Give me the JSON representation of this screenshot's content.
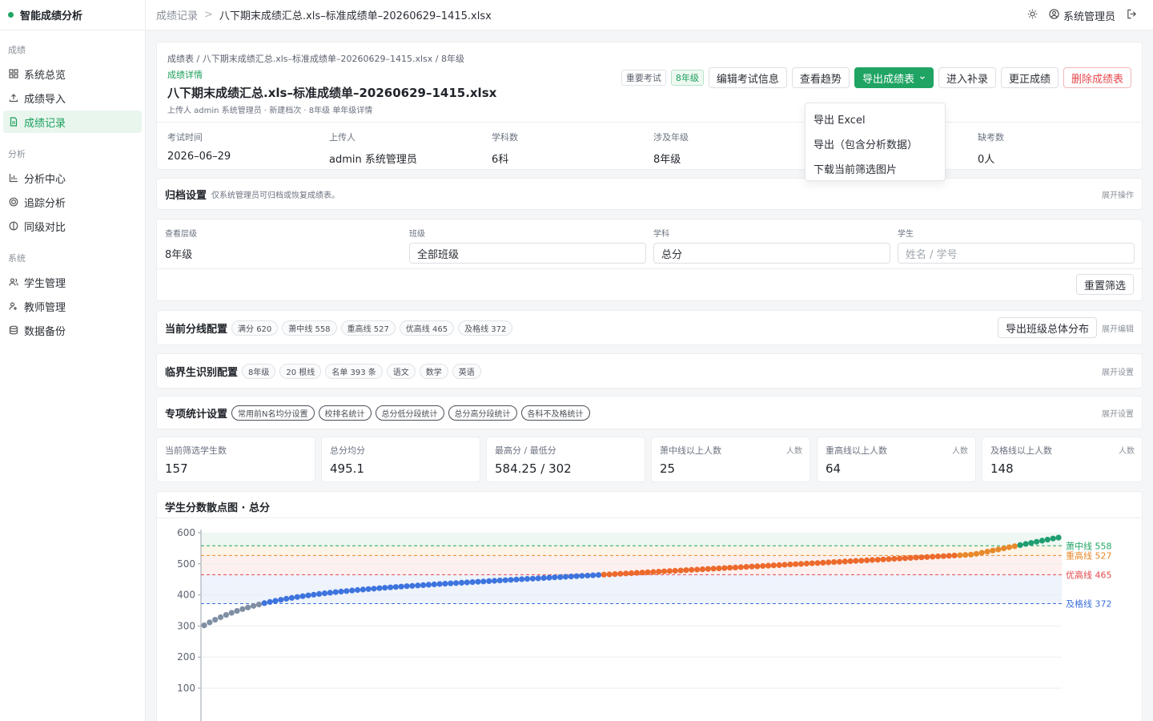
{
  "brand": {
    "name": "智能成绩分析"
  },
  "sidebar": {
    "groups": [
      {
        "label": "成绩",
        "items": [
          {
            "label": "系统总览",
            "icon": "dashboard-icon"
          },
          {
            "label": "成绩导入",
            "icon": "upload-icon"
          },
          {
            "label": "成绩记录",
            "icon": "document-icon",
            "active": true
          }
        ]
      },
      {
        "label": "分析",
        "items": [
          {
            "label": "分析中心",
            "icon": "bar-chart-icon"
          },
          {
            "label": "追踪分析",
            "icon": "target-icon"
          },
          {
            "label": "同级对比",
            "icon": "compare-icon"
          }
        ]
      },
      {
        "label": "系统",
        "items": [
          {
            "label": "学生管理",
            "icon": "users-icon"
          },
          {
            "label": "教师管理",
            "icon": "teacher-icon"
          },
          {
            "label": "数据备份",
            "icon": "database-icon"
          }
        ]
      }
    ]
  },
  "topbar": {
    "breadcrumb_root": "成绩记录",
    "breadcrumb_sep": ">",
    "breadcrumb_current": "八下期末成绩汇总.xls–标准成绩单–20260629–1415.xlsx",
    "user": "系统管理员"
  },
  "header": {
    "crumbs": "成绩表 / 八下期末成绩汇总.xls–标准成绩单–20260629–1415.xlsx / 8年级",
    "subtitle": "成绩详情",
    "title": "八下期末成绩汇总.xls–标准成绩单–20260629–1415.xlsx",
    "meta": "上传人 admin 系统管理员 · 新建档次 · 8年级 单年级详情",
    "tags": [
      "重要考试",
      "8年级"
    ],
    "buttons": {
      "edit": "编辑考试信息",
      "trend": "查看趋势",
      "export": "导出成绩表",
      "makeup": "进入补录",
      "correct": "更正成绩",
      "delete": "删除成绩表"
    },
    "stats": [
      {
        "label": "考试时间",
        "value": "2026–06–29"
      },
      {
        "label": "上传人",
        "value": "admin 系统管理员"
      },
      {
        "label": "学科数",
        "value": "6科"
      },
      {
        "label": "涉及年级",
        "value": "8年级"
      },
      {
        "label": "缺考数",
        "value": "0人"
      }
    ]
  },
  "export_menu": [
    "导出 Excel",
    "导出（包含分析数据）",
    "下载当前筛选图片"
  ],
  "archive": {
    "title": "归档设置",
    "note": "仅系统管理员可归档或恢复成绩表。",
    "action": "展开操作"
  },
  "filters": {
    "level": {
      "label": "查看层级",
      "value": "8年级"
    },
    "class": {
      "label": "班级",
      "value": "全部班级"
    },
    "subject": {
      "label": "学科",
      "value": "总分"
    },
    "student": {
      "label": "学生",
      "placeholder": "姓名 / 学号"
    },
    "reset": "重置筛选"
  },
  "score_lines": {
    "title": "当前分线配置",
    "pills": [
      "满分 620",
      "萧中线 558",
      "重高线 527",
      "优高线 465",
      "及格线 372"
    ],
    "export_btn": "导出班级总体分布",
    "action": "展开编辑"
  },
  "critical": {
    "title": "临界生识别配置",
    "pills": [
      "8年级",
      "20 根线",
      "名单 393 条",
      "语文",
      "数学",
      "英语"
    ],
    "action": "展开设置"
  },
  "special": {
    "title": "专项统计设置",
    "pills": [
      "常用前N名均分设置",
      "校排名统计",
      "总分低分段统计",
      "总分高分段统计",
      "各科不及格统计"
    ],
    "action": "展开设置"
  },
  "kpis": [
    {
      "label": "当前筛选学生数",
      "value": "157",
      "unit": ""
    },
    {
      "label": "总分均分",
      "value": "495.1",
      "unit": ""
    },
    {
      "label": "最高分 / 最低分",
      "value": "584.25 / 302",
      "unit": ""
    },
    {
      "label": "萧中线以上人数",
      "value": "25",
      "unit": "人数"
    },
    {
      "label": "重高线以上人数",
      "value": "64",
      "unit": "人数"
    },
    {
      "label": "及格线以上人数",
      "value": "148",
      "unit": "人数"
    }
  ],
  "chart_data": {
    "type": "scatter",
    "title": "学生分数散点图 · 总分",
    "n": 157,
    "min": 302,
    "max": 584.25,
    "ylim": [
      100,
      600
    ],
    "yticks": [
      600,
      500,
      400,
      300,
      200,
      100
    ],
    "lines": [
      {
        "name": "萧中线",
        "value": 558,
        "color": "#1fa463",
        "label": "萧中线 558"
      },
      {
        "name": "重高线",
        "value": 527,
        "color": "#e8892b",
        "label": "重高线 527"
      },
      {
        "name": "优高线",
        "value": 465,
        "color": "#e5484d",
        "label": "优高线 465"
      },
      {
        "name": "及格线",
        "value": 372,
        "color": "#3b6fd9",
        "label": "及格线 372"
      }
    ],
    "colors": {
      "low": "#7f8ea3",
      "pass": "#3d74de",
      "good": "#ec6a2c",
      "key": "#e8892b",
      "top": "#1f9e70"
    }
  }
}
